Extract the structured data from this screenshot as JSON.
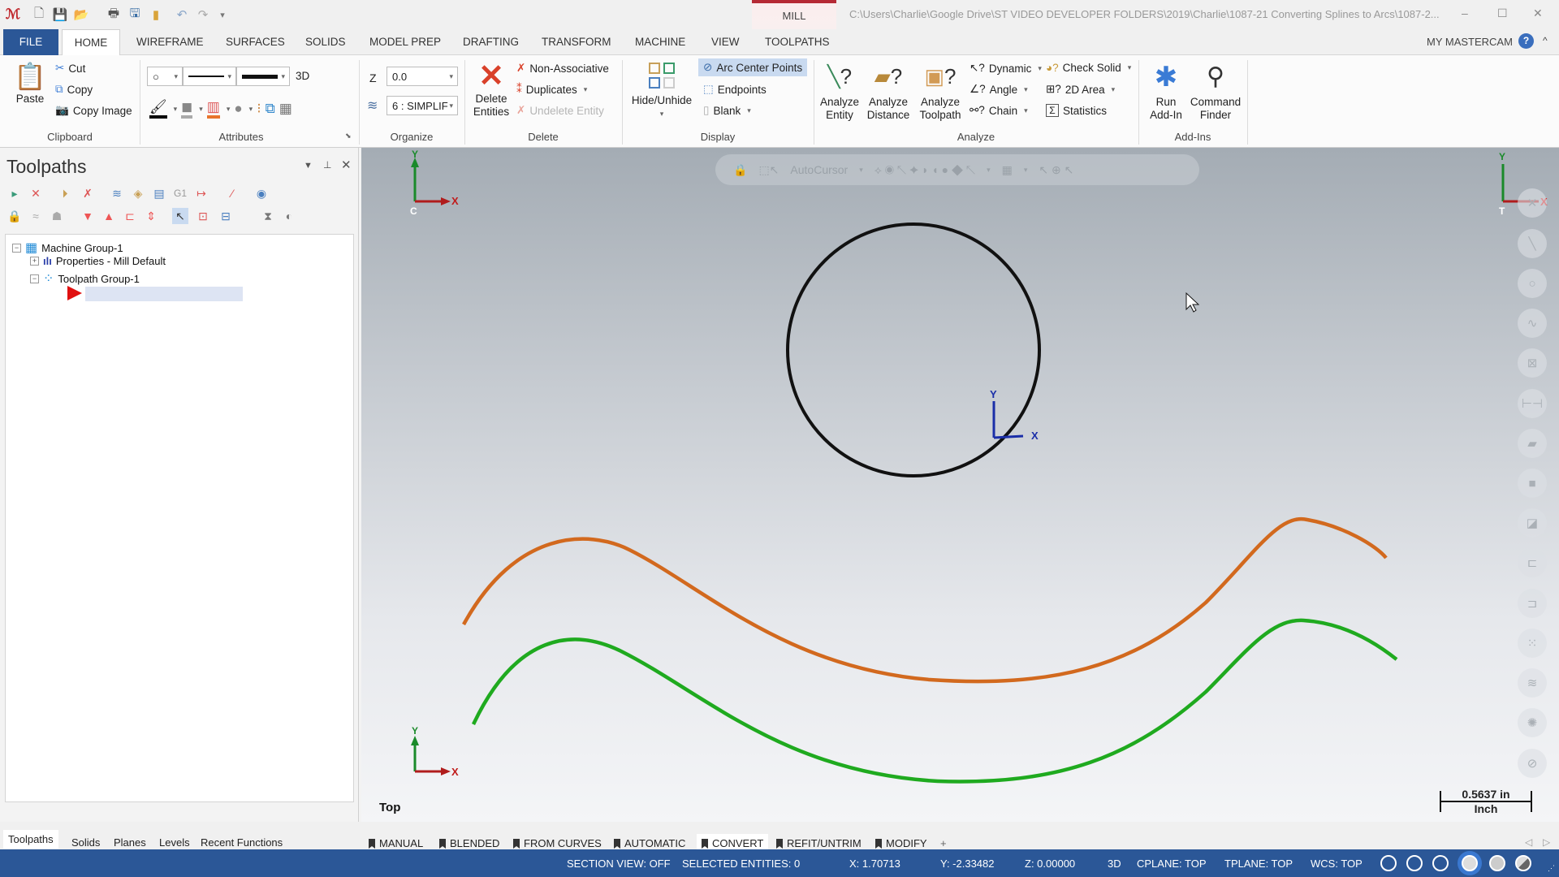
{
  "app": {
    "context_tab": "MILL",
    "file_path": "C:\\Users\\Charlie\\Google Drive\\ST VIDEO DEVELOPER FOLDERS\\2019\\Charlie\\1087-21 Converting Splines to Arcs\\1087-2...",
    "window_controls": {
      "minimize": "–",
      "maximize": "☐",
      "close": "✕"
    },
    "my_mastercam": "MY MASTERCAM",
    "help": "?",
    "collapse": "^"
  },
  "tabs": [
    "FILE",
    "HOME",
    "WIREFRAME",
    "SURFACES",
    "SOLIDS",
    "MODEL PREP",
    "DRAFTING",
    "TRANSFORM",
    "MACHINE",
    "VIEW",
    "TOOLPATHS"
  ],
  "active_tab": "HOME",
  "ribbon": {
    "clipboard": {
      "label": "Clipboard",
      "paste": "Paste",
      "cut": "Cut",
      "copy": "Copy",
      "copy_image": "Copy Image"
    },
    "attributes": {
      "label": "Attributes",
      "point_style": "○",
      "mode_3d": "3D"
    },
    "organize": {
      "label": "Organize",
      "z_label": "Z",
      "z_value": "0.0",
      "level_value": "6 : SIMPLIF"
    },
    "delete": {
      "label": "Delete",
      "delete_entities": "Delete Entities",
      "non_associative": "Non-Associative",
      "duplicates": "Duplicates",
      "undelete_entity": "Undelete Entity"
    },
    "display": {
      "label": "Display",
      "hide_unhide": "Hide/Unhide",
      "arc_center_points": "Arc Center Points",
      "endpoints": "Endpoints",
      "blank": "Blank"
    },
    "analyze": {
      "label": "Analyze",
      "analyze_entity": "Analyze Entity",
      "analyze_distance": "Analyze Distance",
      "analyze_toolpath": "Analyze Toolpath",
      "dynamic": "Dynamic",
      "angle": "Angle",
      "chain": "Chain",
      "check_solid": "Check Solid",
      "area_2d": "2D Area",
      "statistics": "Statistics"
    },
    "addins": {
      "label": "Add-Ins",
      "run_addin": "Run Add-In",
      "command_finder": "Command Finder"
    }
  },
  "panel": {
    "title": "Toolpaths",
    "tree": [
      {
        "label": "Machine Group-1",
        "level": 0
      },
      {
        "label": "Properties - Mill Default",
        "level": 1
      },
      {
        "label": "Toolpath Group-1",
        "level": 1
      }
    ],
    "new_item_value": ""
  },
  "viewport": {
    "view_name": "Top",
    "autocursor": "AutoCursor",
    "scale_value": "0.5637 in",
    "scale_unit": "Inch",
    "axis_labels": {
      "x": "X",
      "y": "Y",
      "c": "C",
      "t": "T"
    },
    "colors": {
      "circle": "#111111",
      "spline_orange": "#d2691e",
      "spline_green": "#1faa1f"
    }
  },
  "bottom_tabs": [
    "Toolpaths",
    "Solids",
    "Planes",
    "Levels",
    "Recent Functions"
  ],
  "mgr_tabs": [
    "MANUAL",
    "BLENDED",
    "FROM CURVES",
    "AUTOMATIC",
    "CONVERT",
    "REFIT/UNTRIM",
    "MODIFY"
  ],
  "mgr_active": "CONVERT",
  "mgr_add": "+",
  "status": {
    "section_view": "SECTION VIEW: OFF",
    "selected_entities": "SELECTED ENTITIES: 0",
    "x": "X:  1.70713",
    "y": "Y:  -2.33482",
    "z": "Z:  0.00000",
    "mode": "3D",
    "cplane": "CPLANE: TOP",
    "tplane": "TPLANE: TOP",
    "wcs": "WCS: TOP"
  }
}
